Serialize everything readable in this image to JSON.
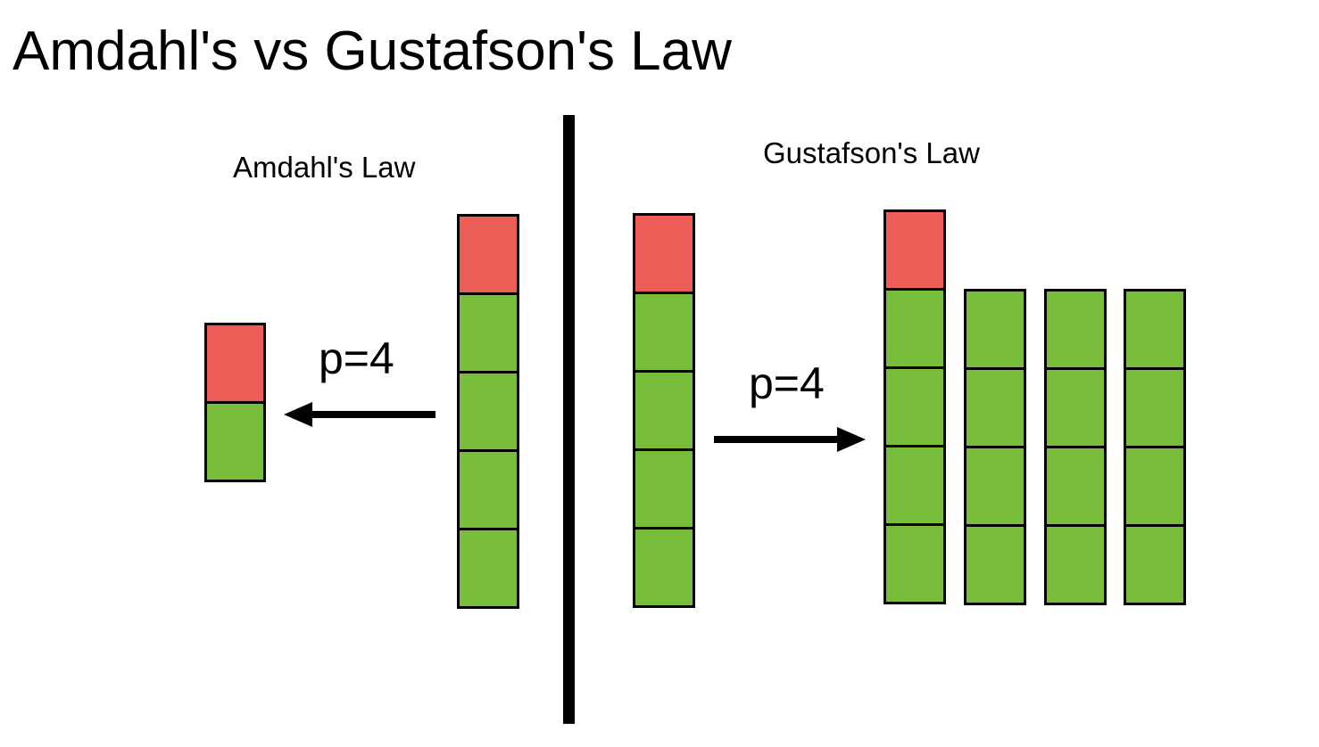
{
  "title": "Amdahl's vs Gustafson's Law",
  "amdahl": {
    "label": "Amdahl's Law",
    "p_label": "p=4",
    "original_stack": {
      "serial_blocks": 1,
      "parallel_blocks": 4
    },
    "result_stack": {
      "serial_blocks": 1,
      "parallel_blocks": 1
    },
    "arrow_direction": "left"
  },
  "gustafson": {
    "label": "Gustafson's Law",
    "p_label": "p=4",
    "original_stack": {
      "serial_blocks": 1,
      "parallel_blocks": 4
    },
    "result_stacks": [
      {
        "serial_blocks": 1,
        "parallel_blocks": 4
      },
      {
        "serial_blocks": 0,
        "parallel_blocks": 4
      },
      {
        "serial_blocks": 0,
        "parallel_blocks": 4
      },
      {
        "serial_blocks": 0,
        "parallel_blocks": 4
      }
    ],
    "arrow_direction": "right"
  },
  "colors": {
    "serial": "#ed5e58",
    "parallel": "#77bd39",
    "outline": "#000000"
  }
}
